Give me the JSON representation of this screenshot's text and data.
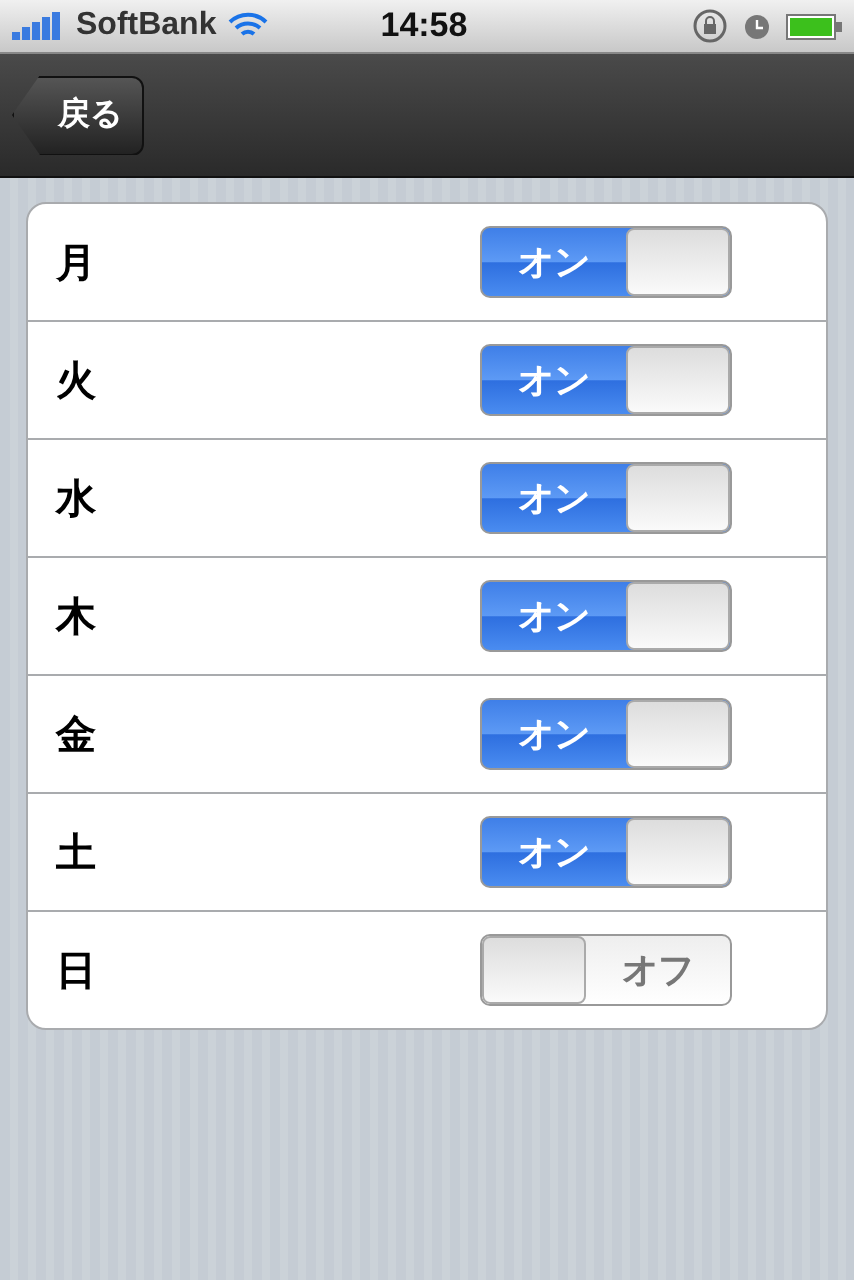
{
  "status_bar": {
    "carrier": "SoftBank",
    "time": "14:58"
  },
  "nav_bar": {
    "back_button": "戻る"
  },
  "rows": [
    {
      "label": "月",
      "on": true,
      "switch_text": "オン"
    },
    {
      "label": "火",
      "on": true,
      "switch_text": "オン"
    },
    {
      "label": "水",
      "on": true,
      "switch_text": "オン"
    },
    {
      "label": "木",
      "on": true,
      "switch_text": "オン"
    },
    {
      "label": "金",
      "on": true,
      "switch_text": "オン"
    },
    {
      "label": "土",
      "on": true,
      "switch_text": "オン"
    },
    {
      "label": "日",
      "on": false,
      "switch_text": "オフ"
    }
  ]
}
